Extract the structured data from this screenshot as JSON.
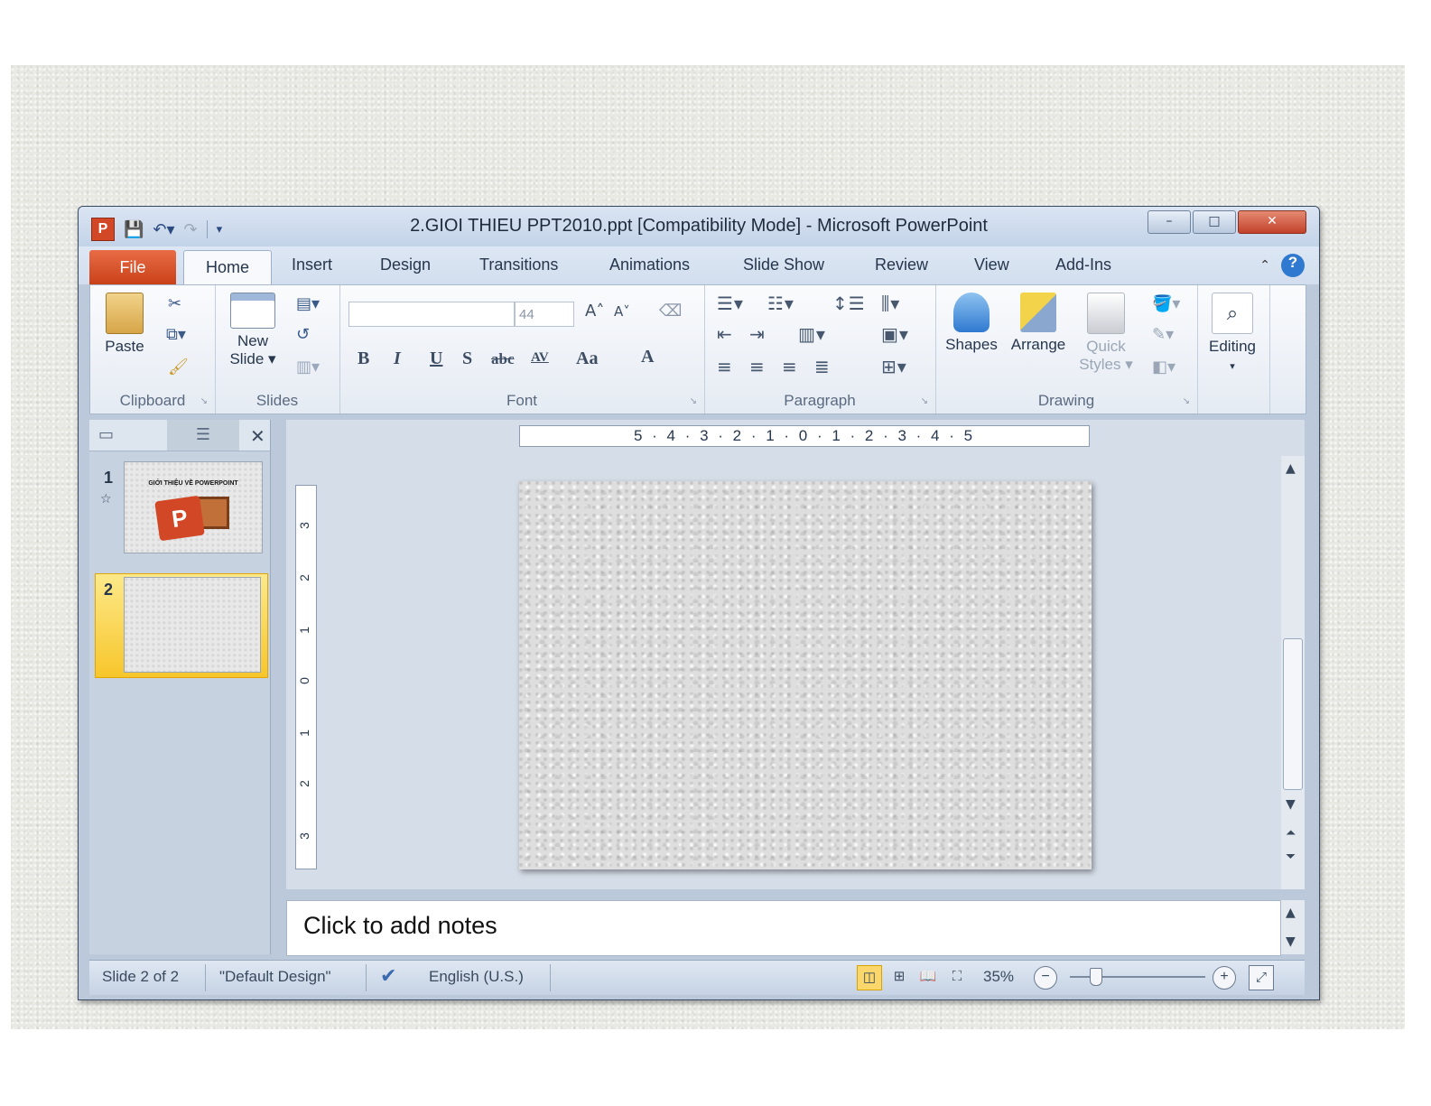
{
  "window": {
    "title": "2.GIOI THIEU PPT2010.ppt [Compatibility Mode]  -  Microsoft PowerPoint",
    "app_icon_letter": "P",
    "controls": {
      "minimize": "–",
      "restore": "□",
      "close": "✕"
    }
  },
  "tabs": [
    "File",
    "Home",
    "Insert",
    "Design",
    "Transitions",
    "Animations",
    "Slide Show",
    "Review",
    "View",
    "Add-Ins"
  ],
  "ribbon": {
    "clipboard": {
      "label": "Clipboard",
      "paste": "Paste"
    },
    "slides": {
      "label": "Slides",
      "new_slide_line1": "New",
      "new_slide_line2": "Slide ▾"
    },
    "font": {
      "label": "Font",
      "font_name": "",
      "font_size": "44",
      "bold": "B",
      "italic": "I",
      "underline": "U",
      "shadow": "S",
      "strike": "abc",
      "spacing": "AV",
      "case": "Aa",
      "color": "A"
    },
    "paragraph": {
      "label": "Paragraph"
    },
    "drawing": {
      "label": "Drawing",
      "shapes": "Shapes",
      "arrange": "Arrange",
      "quick_styles_line1": "Quick",
      "quick_styles_line2": "Styles ▾"
    },
    "editing": {
      "label": "Editing"
    }
  },
  "slides_panel": {
    "slides": [
      {
        "number": "1",
        "title": "GIỚI THIỆU VỀ POWERPOINT"
      },
      {
        "number": "2",
        "title": ""
      }
    ],
    "close": "✕"
  },
  "rulers": {
    "horizontal": "5 · 4 · 3 · 2 · 1 · 0 · 1 · 2 · 3 · 4 · 5",
    "vertical": [
      "3",
      "2",
      "1",
      "0",
      "1",
      "2",
      "3"
    ]
  },
  "notes": {
    "placeholder": "Click to add notes"
  },
  "status": {
    "slide_info": "Slide 2 of 2",
    "theme": "\"Default Design\"",
    "language": "English (U.S.)",
    "zoom": "35%"
  },
  "colors": {
    "file_tab": "#d24726",
    "selected_thumb": "#f7c62b",
    "accent": "#2f79d0"
  }
}
